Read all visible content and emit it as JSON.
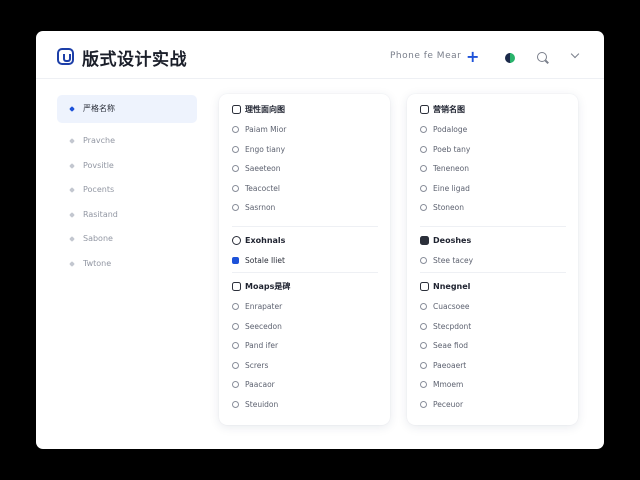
{
  "header": {
    "title": "版式设计实战",
    "link": "Phone  fe  Mear",
    "plus": "+"
  },
  "sidebar": {
    "items": [
      {
        "label": "严格名称"
      },
      {
        "label": "Pravche"
      },
      {
        "label": "Povsitle"
      },
      {
        "label": "Pocents"
      },
      {
        "label": "Rasitand"
      },
      {
        "label": "Sabone"
      },
      {
        "label": "Twtone"
      }
    ]
  },
  "cards": [
    {
      "sections": [
        {
          "title": "理性面向图",
          "rows": [
            "Paiam Mior",
            "Engo tiany",
            "Saeeteon",
            "Teacoctel",
            "Sasrnon"
          ]
        },
        {
          "title": "Exohnals",
          "icon": "circle",
          "rows": [
            "Sotale Iliet"
          ]
        },
        {
          "title": "Moaps是碑",
          "rows": [
            "Enrapater",
            "Seecedon",
            "Pand ifer",
            "Scrers",
            "Paacaor",
            "Steuidon"
          ]
        }
      ]
    },
    {
      "sections": [
        {
          "title": "营销名图",
          "rows": [
            "Podaloge",
            "Poeb tany",
            "Teneneon",
            "Eine ligad",
            "Stoneon"
          ]
        },
        {
          "title": "Deoshes",
          "icon": "square",
          "rows": [
            "Stee tacey"
          ]
        },
        {
          "title": "Nnegnel",
          "rows": [
            "Cuacsoee",
            "Stecpdont",
            "Seae fiod",
            "Paeoaert",
            "Mmoem",
            "Peceuor"
          ]
        }
      ]
    }
  ],
  "colors": {
    "accent": "#1d52d9",
    "brand_dark": "#1d3fa8",
    "active_bg": "#eef3fd"
  }
}
